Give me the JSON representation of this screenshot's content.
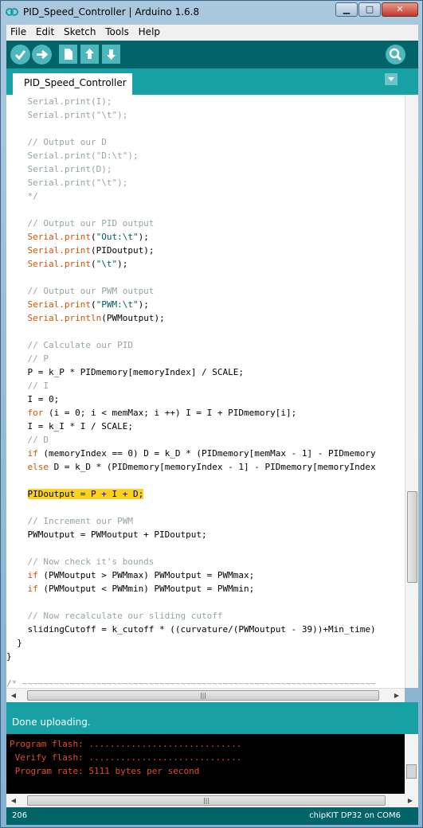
{
  "window": {
    "title": "PID_Speed_Controller | Arduino 1.6.8",
    "minimize_label": "▁",
    "maximize_label": "□",
    "close_label": "✕"
  },
  "menu": {
    "items": [
      "File",
      "Edit",
      "Sketch",
      "Tools",
      "Help"
    ]
  },
  "toolbar": {
    "icons": [
      "verify-icon",
      "upload-icon",
      "new-icon",
      "open-icon",
      "save-icon",
      "serial-monitor-icon"
    ]
  },
  "tabs": {
    "active": "PID_Speed_Controller"
  },
  "editor": {
    "lines": [
      {
        "t": "    Serial.print(I);",
        "k": "comment"
      },
      {
        "t": "    Serial.print(\"\\t\");",
        "k": "comment"
      },
      {
        "t": "",
        "k": "plain"
      },
      {
        "t": "    // Output our D",
        "k": "comment"
      },
      {
        "t": "    Serial.print(\"D:\\t\");",
        "k": "comment"
      },
      {
        "t": "    Serial.print(D);",
        "k": "comment"
      },
      {
        "t": "    Serial.print(\"\\t\");",
        "k": "comment"
      },
      {
        "t": "    */",
        "k": "comment"
      },
      {
        "t": "",
        "k": "plain"
      },
      {
        "t": "    // Output our PID output",
        "k": "comment"
      },
      {
        "t": "    Serial.print(\"Out:\\t\");",
        "k": "call"
      },
      {
        "t": "    Serial.print(PIDoutput);",
        "k": "call"
      },
      {
        "t": "    Serial.print(\"\\t\");",
        "k": "call"
      },
      {
        "t": "",
        "k": "plain"
      },
      {
        "t": "    // Output our PWM output",
        "k": "comment"
      },
      {
        "t": "    Serial.print(\"PWM:\\t\");",
        "k": "call"
      },
      {
        "t": "    Serial.println(PWMoutput);",
        "k": "call"
      },
      {
        "t": "",
        "k": "plain"
      },
      {
        "t": "    // Calculate our PID",
        "k": "comment"
      },
      {
        "t": "    // P",
        "k": "comment"
      },
      {
        "t": "    P = k_P * PIDmemory[memoryIndex] / SCALE;",
        "k": "plain"
      },
      {
        "t": "    // I",
        "k": "comment"
      },
      {
        "t": "    I = 0;",
        "k": "plain"
      },
      {
        "t": "    for (i = 0; i < memMax; i ++) I = I + PIDmemory[i];",
        "k": "for"
      },
      {
        "t": "    I = k_I * I / SCALE;",
        "k": "plain"
      },
      {
        "t": "    // D",
        "k": "comment"
      },
      {
        "t": "    if (memoryIndex == 0) D = k_D * (PIDmemory[memMax - 1] - PIDmemory",
        "k": "if"
      },
      {
        "t": "    else D = k_D * (PIDmemory[memoryIndex - 1] - PIDmemory[memoryIndex",
        "k": "else"
      },
      {
        "t": "",
        "k": "plain"
      },
      {
        "t": "    PIDoutput = P + I + D;",
        "k": "highlight"
      },
      {
        "t": "",
        "k": "plain"
      },
      {
        "t": "    // Increment our PWM",
        "k": "comment"
      },
      {
        "t": "    PWMoutput = PWMoutput + PIDoutput;",
        "k": "plain"
      },
      {
        "t": "",
        "k": "plain"
      },
      {
        "t": "    // Now check it's bounds",
        "k": "comment"
      },
      {
        "t": "    if (PWMoutput > PWMmax) PWMoutput = PWMmax;",
        "k": "if"
      },
      {
        "t": "    if (PWMoutput < PWMmin) PWMoutput = PWMmin;",
        "k": "if"
      },
      {
        "t": "",
        "k": "plain"
      },
      {
        "t": "    // Now recalculate our sliding cutoff",
        "k": "comment"
      },
      {
        "t": "    slidingCutoff = k_cutoff * ((curvature/(PWMoutput - 39))+Min_time)",
        "k": "plain"
      },
      {
        "t": "  }",
        "k": "plain"
      },
      {
        "t": "}",
        "k": "plain"
      },
      {
        "t": "",
        "k": "plain"
      },
      {
        "t": "/* ~~~~~~~~~~~~~~~~~~~~~~~~~~~~~~~~~~~~~~~~~~~~~~~~~~~~~~~~~~~~~~~~~~~",
        "k": "comment"
      }
    ]
  },
  "status": {
    "message": "Done uploading."
  },
  "console": {
    "lines": [
      "Program flash: .............................",
      " Verify flash: .............................",
      " Program rate: 5111 bytes per second"
    ]
  },
  "footer": {
    "line_number": "206",
    "board": "chipKIT DP32 on COM6"
  },
  "colors": {
    "toolbar": "#006468",
    "tabbar": "#17a1a5",
    "highlight": "#f9d21f",
    "keyword": "#d35400",
    "comment": "#95a5a6",
    "console_text": "#e34c26"
  }
}
